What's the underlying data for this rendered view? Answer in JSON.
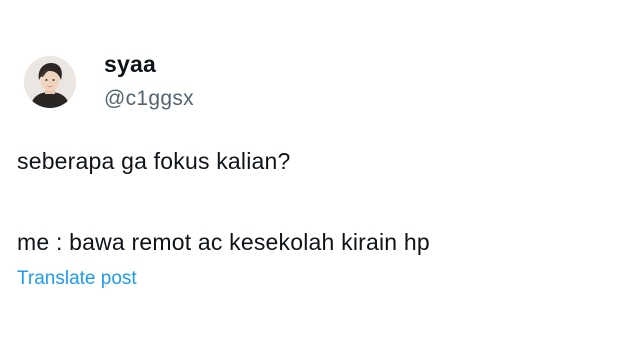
{
  "author": {
    "display_name": "syaa",
    "handle": "@c1ggsx",
    "avatar_icon": "user-avatar"
  },
  "post": {
    "lines": [
      "seberapa ga fokus kalian?",
      "me : bawa remot ac kesekolah kirain hp"
    ]
  },
  "actions": {
    "translate_label": "Translate post"
  },
  "colors": {
    "text_primary": "#0f1419",
    "text_secondary": "#536471",
    "link": "#1d9bf0",
    "background": "#ffffff"
  }
}
